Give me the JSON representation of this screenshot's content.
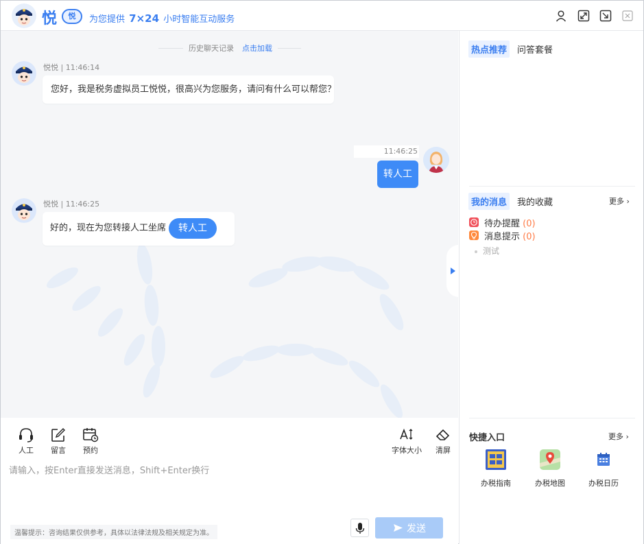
{
  "header": {
    "brand_name": "悦",
    "brand_badge": "悦",
    "slogan_pre": "为您提供",
    "slogan_highlight": "7×24",
    "slogan_post": "小时智能互动服务",
    "controls": [
      "user-icon",
      "fullscreen-icon",
      "minimize-icon",
      "close-icon"
    ]
  },
  "chat": {
    "history_label": "历史聊天记录",
    "history_link": "点击加载",
    "messages": [
      {
        "sender": "悦悦",
        "time": "11:46:14",
        "text": "您好，我是税务虚拟员工悦悦，很高兴为您服务，请问有什么可以帮您？"
      },
      {
        "sender": "user",
        "time": "11:46:25",
        "text": "转人工"
      },
      {
        "sender": "悦悦",
        "time": "11:46:25",
        "text": "好的，现在为您转接人工坐席",
        "button": "转人工"
      }
    ],
    "meta_separator": " | "
  },
  "toolbar": {
    "left_tools": [
      {
        "icon": "headset-icon",
        "label": "人工"
      },
      {
        "icon": "edit-icon",
        "label": "留言"
      },
      {
        "icon": "calendar-clock-icon",
        "label": "预约"
      }
    ],
    "right_tools": [
      {
        "icon": "font-size-icon",
        "label": "字体大小"
      },
      {
        "icon": "eraser-icon",
        "label": "清屏"
      }
    ]
  },
  "input": {
    "placeholder": "请输入，按Enter直接发送消息，Shift+Enter换行",
    "value": "",
    "notice": "温馨提示：咨询结果仅供参考，具体以法律法规及相关规定为准。",
    "send_label": "发送"
  },
  "side": {
    "top_tabs": [
      "热点推荐",
      "问答套餐"
    ],
    "active_top_tab": 0,
    "msg_tabs": [
      "我的消息",
      "我的收藏"
    ],
    "active_msg_tab": 0,
    "more_label": "更多",
    "messages": [
      {
        "icon": "clock-icon",
        "label": "待办提醒",
        "count": "(0)"
      },
      {
        "icon": "bulb-icon",
        "label": "消息提示",
        "count": "(0)"
      }
    ],
    "sub_item": "测试",
    "quick_title": "快捷入口",
    "quick_more": "更多",
    "quick_items": [
      {
        "icon": "guide-icon",
        "label": "办税指南"
      },
      {
        "icon": "map-icon",
        "label": "办税地图"
      },
      {
        "icon": "calendar-icon",
        "label": "办税日历"
      }
    ]
  },
  "colors": {
    "accent": "#3a7ef0",
    "bubble_blue": "#3e8bf7",
    "chat_bg": "#f5f6f8",
    "count_orange": "#ff7a45",
    "send_disabled": "#a9cbf8"
  }
}
